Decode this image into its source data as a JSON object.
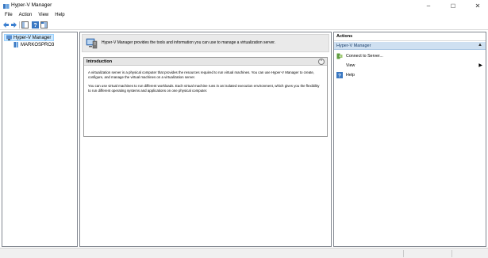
{
  "window": {
    "title": "Hyper-V Manager",
    "minimize_glyph": "–",
    "maximize_glyph": "☐",
    "close_glyph": "✕"
  },
  "menu": {
    "items": [
      "File",
      "Action",
      "View",
      "Help"
    ]
  },
  "toolbar": {
    "icons": [
      "back-arrow-icon",
      "forward-arrow-icon",
      "show-hide-console-tree-icon",
      "help-icon",
      "show-hide-action-pane-icon"
    ]
  },
  "tree": {
    "root_label": "Hyper-V Manager",
    "child_label": "MARKOSPRO3"
  },
  "banner": {
    "text": "Hyper-V Manager provides the tools and information you can use to manage a virtualization server."
  },
  "intro": {
    "title": "Introduction",
    "collapse_glyph": "⌃",
    "paragraph1": "A virtualization server is a physical computer that provides the resources required to run virtual machines. You can use Hyper-V Manager to create, configure, and manage the virtual machines on a virtualization server.",
    "paragraph2": "You can use virtual machines to run different workloads. Each virtual machine runs in an isolated execution environment, which gives you the flexibility to run different operating systems and applications on one physical computer."
  },
  "actions": {
    "title": "Actions",
    "group_label": "Hyper-V Manager",
    "group_caret": "▲",
    "items": [
      {
        "label": "Connect to Server...",
        "icon": "connect-server-icon"
      },
      {
        "label": "View",
        "icon": "",
        "arrow": "▶"
      },
      {
        "label": "Help",
        "icon": "help-icon"
      }
    ]
  },
  "colors": {
    "selection": "#cce8ff",
    "group_header": "#cfe0f1",
    "accent_blue": "#1e73be"
  }
}
